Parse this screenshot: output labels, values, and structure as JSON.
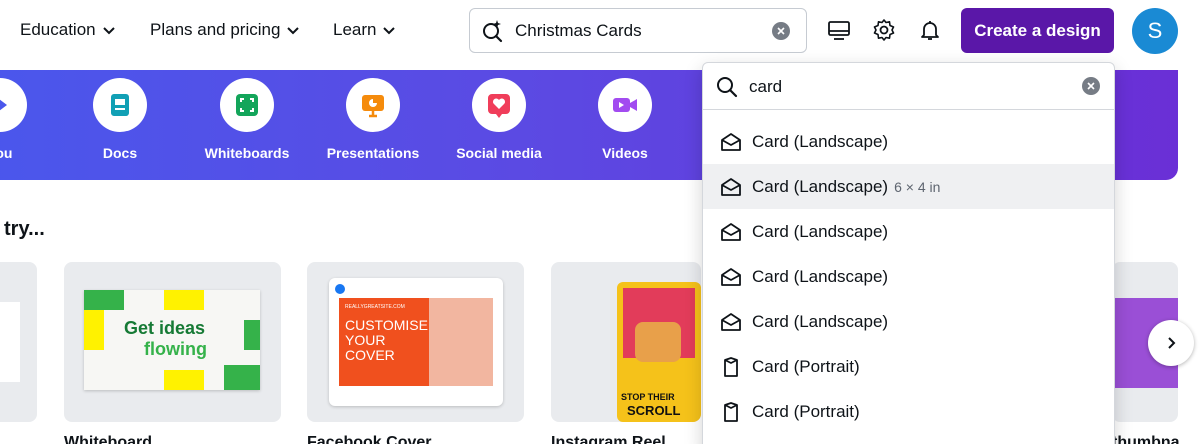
{
  "nav": {
    "items": [
      "Education",
      "Plans and pricing",
      "Learn"
    ],
    "search_value": "Christmas Cards",
    "create_label": "Create a design",
    "avatar_initial": "S"
  },
  "banner": {
    "partial_label": "you",
    "categories": [
      {
        "label": "Docs",
        "icon": "docs-icon",
        "color": "#11a0b5"
      },
      {
        "label": "Whiteboards",
        "icon": "whiteboard-icon",
        "color": "#13a55a"
      },
      {
        "label": "Presentations",
        "icon": "presentation-icon",
        "color": "#f58b0c"
      },
      {
        "label": "Social media",
        "icon": "heart-icon",
        "color": "#f03d5a"
      },
      {
        "label": "Videos",
        "icon": "video-icon",
        "color": "#a24bf0"
      }
    ]
  },
  "section": {
    "title": "try...",
    "card_labels": [
      "Whiteboard",
      "Facebook Cover",
      "Instagram Reel",
      "thumbna"
    ],
    "thumbnails": {
      "whiteboard_text": [
        "Get ideas",
        "flowing"
      ],
      "facebook_url": "REALLYGREATSITE.COM",
      "facebook_text": [
        "CUSTOMISE",
        "YOUR",
        "COVER"
      ],
      "reel_text": [
        "STOP THEIR",
        "SCROLL"
      ]
    }
  },
  "dropdown": {
    "query": "card",
    "results": [
      {
        "label": "Card (Landscape)",
        "dims": "",
        "icon": "card-landscape-icon"
      },
      {
        "label": "Card (Landscape)",
        "dims": "6 × 4 in",
        "icon": "card-landscape-icon"
      },
      {
        "label": "Card (Landscape)",
        "dims": "",
        "icon": "card-landscape-icon"
      },
      {
        "label": "Card (Landscape)",
        "dims": "",
        "icon": "card-landscape-icon"
      },
      {
        "label": "Card (Landscape)",
        "dims": "",
        "icon": "card-landscape-icon"
      },
      {
        "label": "Card (Portrait)",
        "dims": "",
        "icon": "card-portrait-icon"
      },
      {
        "label": "Card (Portrait)",
        "dims": "",
        "icon": "card-portrait-icon"
      }
    ]
  },
  "colors": {
    "brand_purple": "#5a17a8",
    "banner_start": "#4a57ec",
    "banner_end": "#6a2fd6",
    "avatar": "#1a8ad4"
  }
}
